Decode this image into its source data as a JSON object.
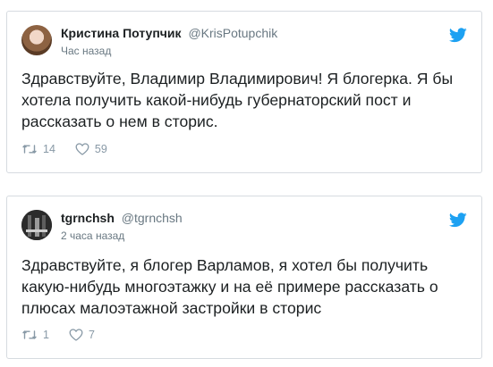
{
  "tweets": [
    {
      "name": "Кристина Потупчик",
      "handle": "@KrisPotupchik",
      "time": "Час назад",
      "text": "Здравствуйте, Владимир Владимирович! Я блогерка. Я бы хотела получить какой-нибудь губернаторский пост и рассказать о нем в сторис.",
      "retweets": "14",
      "likes": "59"
    },
    {
      "name": "tgrnchsh",
      "handle": "@tgrnchsh",
      "time": "2 часа назад",
      "text": "Здравствуйте, я блогер Варламов, я хотел бы получить какую-нибудь многоэтажку и на её примере рассказать о плюсах малоэтажной застройки в сторис",
      "retweets": "1",
      "likes": "7"
    }
  ],
  "colors": {
    "twitter_blue": "#1da1f2",
    "muted": "#8899a6"
  },
  "icons": [
    "twitter-bird-icon",
    "retweet-icon",
    "heart-icon"
  ]
}
